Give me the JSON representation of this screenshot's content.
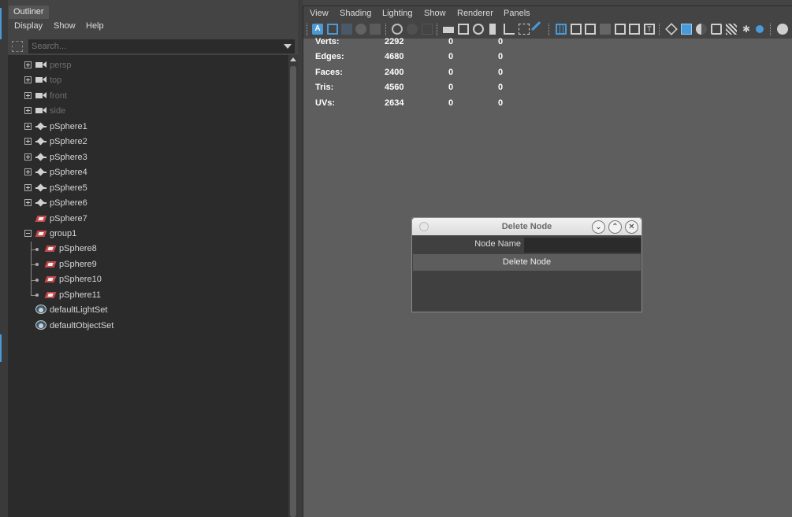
{
  "outliner": {
    "tab_label": "Outliner",
    "menu": [
      "Display",
      "Show",
      "Help"
    ],
    "search_placeholder": "Search...",
    "items": [
      {
        "label": "persp",
        "icon": "camera-icon",
        "dim": true
      },
      {
        "label": "top",
        "icon": "camera-icon",
        "dim": true
      },
      {
        "label": "front",
        "icon": "camera-icon",
        "dim": true
      },
      {
        "label": "side",
        "icon": "camera-icon",
        "dim": true
      },
      {
        "label": "pSphere1",
        "icon": "mesh-icon"
      },
      {
        "label": "pSphere2",
        "icon": "mesh-icon"
      },
      {
        "label": "pSphere3",
        "icon": "mesh-icon"
      },
      {
        "label": "pSphere4",
        "icon": "mesh-icon"
      },
      {
        "label": "pSphere5",
        "icon": "mesh-icon"
      },
      {
        "label": "pSphere6",
        "icon": "mesh-icon"
      },
      {
        "label": "pSphere7",
        "icon": "transform-icon"
      },
      {
        "label": "group1",
        "icon": "transform-icon"
      },
      {
        "label": "pSphere8",
        "icon": "transform-icon"
      },
      {
        "label": "pSphere9",
        "icon": "transform-icon"
      },
      {
        "label": "pSphere10",
        "icon": "transform-icon"
      },
      {
        "label": "pSphere11",
        "icon": "transform-icon"
      },
      {
        "label": "defaultLightSet",
        "icon": "set-icon"
      },
      {
        "label": "defaultObjectSet",
        "icon": "set-icon"
      }
    ]
  },
  "panel": {
    "menu": [
      "View",
      "Shading",
      "Lighting",
      "Show",
      "Renderer",
      "Panels"
    ]
  },
  "hud": {
    "rows": [
      {
        "label": "Verts:",
        "v1": "2292",
        "v2": "0",
        "v3": "0"
      },
      {
        "label": "Edges:",
        "v1": "4680",
        "v2": "0",
        "v3": "0"
      },
      {
        "label": "Faces:",
        "v1": "2400",
        "v2": "0",
        "v3": "0"
      },
      {
        "label": "Tris:",
        "v1": "4560",
        "v2": "0",
        "v3": "0"
      },
      {
        "label": "UVs:",
        "v1": "2634",
        "v2": "0",
        "v3": "0"
      }
    ]
  },
  "dialog": {
    "title": "Delete Node",
    "node_name_label": "Node Name",
    "node_name_value": "",
    "delete_button": "Delete Node",
    "minimize_glyph": "⌄",
    "maximize_glyph": "⌃",
    "close_glyph": "✕"
  },
  "colors": {
    "accent": "#4a9ad8",
    "tree_bg": "#2b2b2b",
    "viewport_bg": "#5e5e5e"
  }
}
